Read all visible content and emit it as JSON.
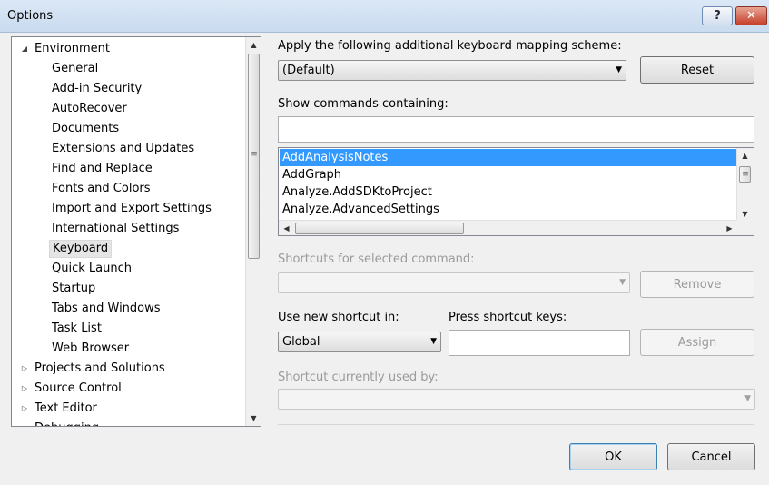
{
  "window": {
    "title": "Options",
    "help_label": "?",
    "close_label": "✕"
  },
  "tree": {
    "items": [
      {
        "label": "Environment",
        "expander": "◢"
      },
      {
        "label": "General"
      },
      {
        "label": "Add-in Security"
      },
      {
        "label": "AutoRecover"
      },
      {
        "label": "Documents"
      },
      {
        "label": "Extensions and Updates"
      },
      {
        "label": "Find and Replace"
      },
      {
        "label": "Fonts and Colors"
      },
      {
        "label": "Import and Export Settings"
      },
      {
        "label": "International Settings"
      },
      {
        "label": "Keyboard"
      },
      {
        "label": "Quick Launch"
      },
      {
        "label": "Startup"
      },
      {
        "label": "Tabs and Windows"
      },
      {
        "label": "Task List"
      },
      {
        "label": "Web Browser"
      },
      {
        "label": "Projects and Solutions",
        "expander": "▷"
      },
      {
        "label": "Source Control",
        "expander": "▷"
      },
      {
        "label": "Text Editor",
        "expander": "▷"
      },
      {
        "label": "Debugging",
        "expander": "▷"
      }
    ],
    "selected": "Keyboard"
  },
  "mapping": {
    "label": "Apply the following additional keyboard mapping scheme:",
    "value": "(Default)",
    "reset_label": "Reset"
  },
  "commands": {
    "label": "Show commands containing:",
    "search_value": "",
    "items": [
      "AddAnalysisNotes",
      "AddGraph",
      "Analyze.AddSDKtoProject",
      "Analyze.AdvancedSettings"
    ],
    "selected": "AddAnalysisNotes"
  },
  "shortcuts": {
    "label": "Shortcuts for selected command:",
    "value": "",
    "remove_label": "Remove"
  },
  "new_shortcut": {
    "use_in_label": "Use new shortcut in:",
    "use_in_value": "Global",
    "press_keys_label": "Press shortcut keys:",
    "press_keys_value": "",
    "assign_label": "Assign"
  },
  "used_by": {
    "label": "Shortcut currently used by:",
    "value": ""
  },
  "footer": {
    "ok_label": "OK",
    "cancel_label": "Cancel"
  },
  "glyphs": {
    "dropdown": "▼",
    "up": "▲",
    "down": "▼",
    "left": "◀",
    "right": "▶",
    "grip": "≡"
  },
  "colors": {
    "selection": "#3399ff",
    "titlebar": "#c9dbef",
    "close": "#c6402a"
  }
}
